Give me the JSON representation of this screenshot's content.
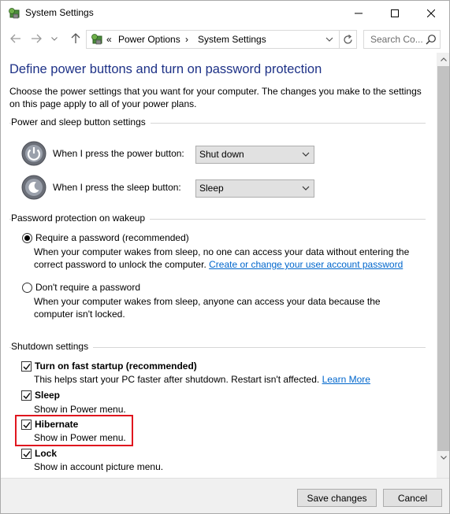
{
  "window": {
    "title": "System Settings",
    "app_icon": "power-options-icon",
    "controls": [
      "minimize-icon",
      "maximize-icon",
      "close-icon"
    ]
  },
  "address_bar": {
    "overflow_glyph": "«",
    "breadcrumbs": [
      "Power Options",
      "System Settings"
    ],
    "separator": "›",
    "search_placeholder": "Search Co..."
  },
  "page": {
    "heading": "Define power buttons and turn on password protection",
    "intro": "Choose the power settings that you want for your computer. The changes you make to the settings on this page apply to all of your power plans."
  },
  "power_buttons": {
    "section_label": "Power and sleep button settings",
    "power_button": {
      "label": "When I press the power button:",
      "value": "Shut down"
    },
    "sleep_button": {
      "label": "When I press the sleep button:",
      "value": "Sleep"
    }
  },
  "password": {
    "section_label": "Password protection on wakeup",
    "require": {
      "label": "Require a password (recommended)",
      "selected": true,
      "desc_line1": "When your computer wakes from sleep, no one can access your data without entering the",
      "desc_line2": "correct password to unlock the computer. ",
      "link": "Create or change your user account password"
    },
    "no_require": {
      "label": "Don't require a password",
      "selected": false,
      "desc_line1": "When your computer wakes from sleep, anyone can access your data because the",
      "desc_line2": "computer isn't locked."
    }
  },
  "shutdown": {
    "section_label": "Shutdown settings",
    "items": [
      {
        "label": "Turn on fast startup (recommended)",
        "desc": "This helps start your PC faster after shutdown. Restart isn't affected. ",
        "link": "Learn More",
        "checked": true
      },
      {
        "label": "Sleep",
        "desc": "Show in Power menu.",
        "checked": true
      },
      {
        "label": "Hibernate",
        "desc": "Show in Power menu.",
        "checked": true,
        "highlighted": true
      },
      {
        "label": "Lock",
        "desc": "Show in account picture menu.",
        "checked": true
      }
    ]
  },
  "footer": {
    "save_label": "Save changes",
    "cancel_label": "Cancel"
  },
  "colors": {
    "heading": "#1e3287",
    "link": "#0066cc",
    "highlight_border": "#e0161e"
  }
}
